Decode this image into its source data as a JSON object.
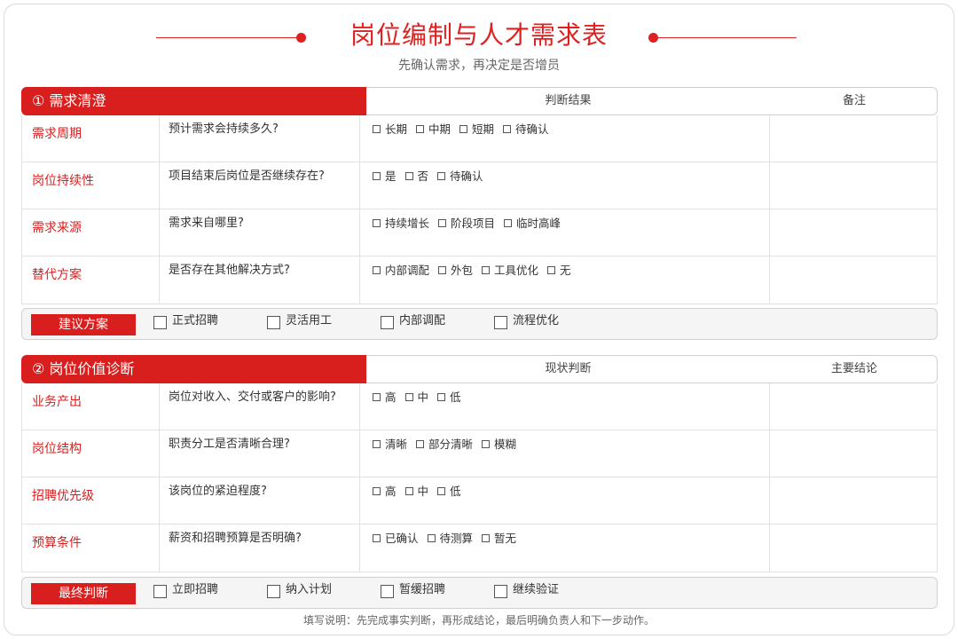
{
  "header": {
    "title": "岗位编制与人才需求表",
    "subtitle": "先确认需求，再决定是否增员"
  },
  "sections": [
    {
      "tab": "① 需求清澄",
      "col_a": "判断结果",
      "col_b": "备注",
      "rows": [
        {
          "label": "需求周期",
          "question": "预计需求会持续多久?",
          "options": [
            "长期",
            "中期",
            "短期",
            "待确认"
          ]
        },
        {
          "label": "岗位持续性",
          "question": "项目结束后岗位是否继续存在?",
          "options": [
            "是",
            "否",
            "待确认"
          ]
        },
        {
          "label": "需求来源",
          "question": "需求来自哪里?",
          "options": [
            "持续增长",
            "阶段项目",
            "临时高峰"
          ]
        },
        {
          "label": "替代方案",
          "question": "是否存在其他解决方式?",
          "options": [
            "内部调配",
            "外包",
            "工具优化",
            "无"
          ]
        }
      ],
      "decision": {
        "label": "建议方案",
        "choices": [
          "正式招聘",
          "灵活用工",
          "内部调配",
          "流程优化"
        ]
      }
    },
    {
      "tab": "② 岗位价值诊断",
      "col_a": "现状判断",
      "col_b": "主要结论",
      "rows": [
        {
          "label": "业务产出",
          "question": "岗位对收入、交付或客户的影响?",
          "options": [
            "高",
            "中",
            "低"
          ]
        },
        {
          "label": "岗位结构",
          "question": "职责分工是否清晰合理?",
          "options": [
            "清晰",
            "部分清晰",
            "模糊"
          ]
        },
        {
          "label": "招聘优先级",
          "question": "该岗位的紧迫程度?",
          "options": [
            "高",
            "中",
            "低"
          ]
        },
        {
          "label": "预算条件",
          "question": "薪资和招聘预算是否明确?",
          "options": [
            "已确认",
            "待测算",
            "暂无"
          ]
        }
      ],
      "decision": {
        "label": "最终判断",
        "choices": [
          "立即招聘",
          "纳入计划",
          "暂缓招聘",
          "继续验证"
        ]
      }
    }
  ],
  "footer": "填写说明：先完成事实判断，再形成结论，最后明确负责人和下一步动作。",
  "colors": {
    "accent": "#d91e1e",
    "title": "#e02020"
  }
}
